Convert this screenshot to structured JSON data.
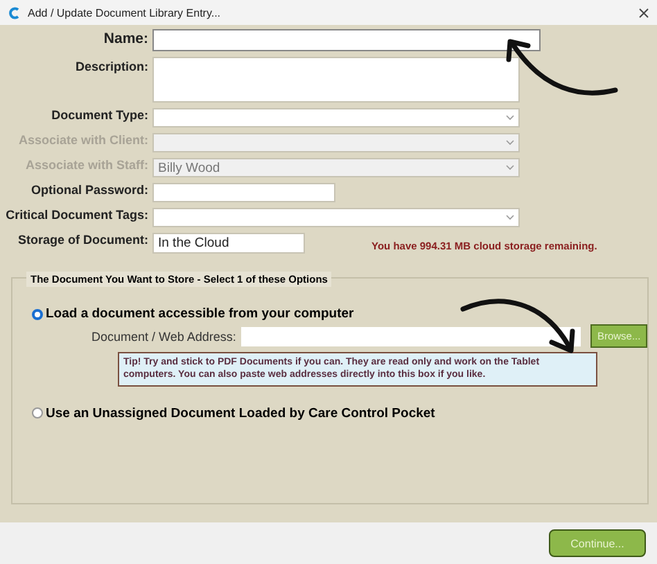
{
  "window": {
    "title": "Add / Update Document Library Entry..."
  },
  "fields": [
    {
      "label": "Name:",
      "kind": "text",
      "disabled": false
    },
    {
      "label": "Description:",
      "kind": "textarea",
      "disabled": false
    },
    {
      "label": "Document Type:",
      "kind": "select",
      "disabled": false
    },
    {
      "label": "Associate with Client:",
      "kind": "select",
      "disabled": true
    },
    {
      "label": "Associate with Staff:",
      "kind": "select",
      "disabled": true,
      "value": "Billy Wood"
    },
    {
      "label": "Optional Password:",
      "kind": "short-text",
      "disabled": false
    },
    {
      "label": "Critical Document Tags:",
      "kind": "select",
      "disabled": false
    },
    {
      "label": "Storage of Document:",
      "kind": "readonly",
      "disabled": false,
      "value": "In the Cloud",
      "note": "You have 994.31 MB cloud storage remaining."
    }
  ],
  "document_group": {
    "title": "The Document You Want to Store - Select 1 of these Options",
    "options": [
      {
        "label": "Load a document accessible from your computer",
        "selected": true,
        "address_label": "Document / Web Address:",
        "browse_button": "Browse...",
        "tip": "Tip! Try and stick to PDF Documents if you can.  They are read only and work on the Tablet computers.  You can also paste web addresses directly into this box if you like."
      },
      {
        "label": "Use an Unassigned Document Loaded by Care Control Pocket",
        "selected": false
      }
    ]
  },
  "footer": {
    "continue_button": "Continue..."
  }
}
